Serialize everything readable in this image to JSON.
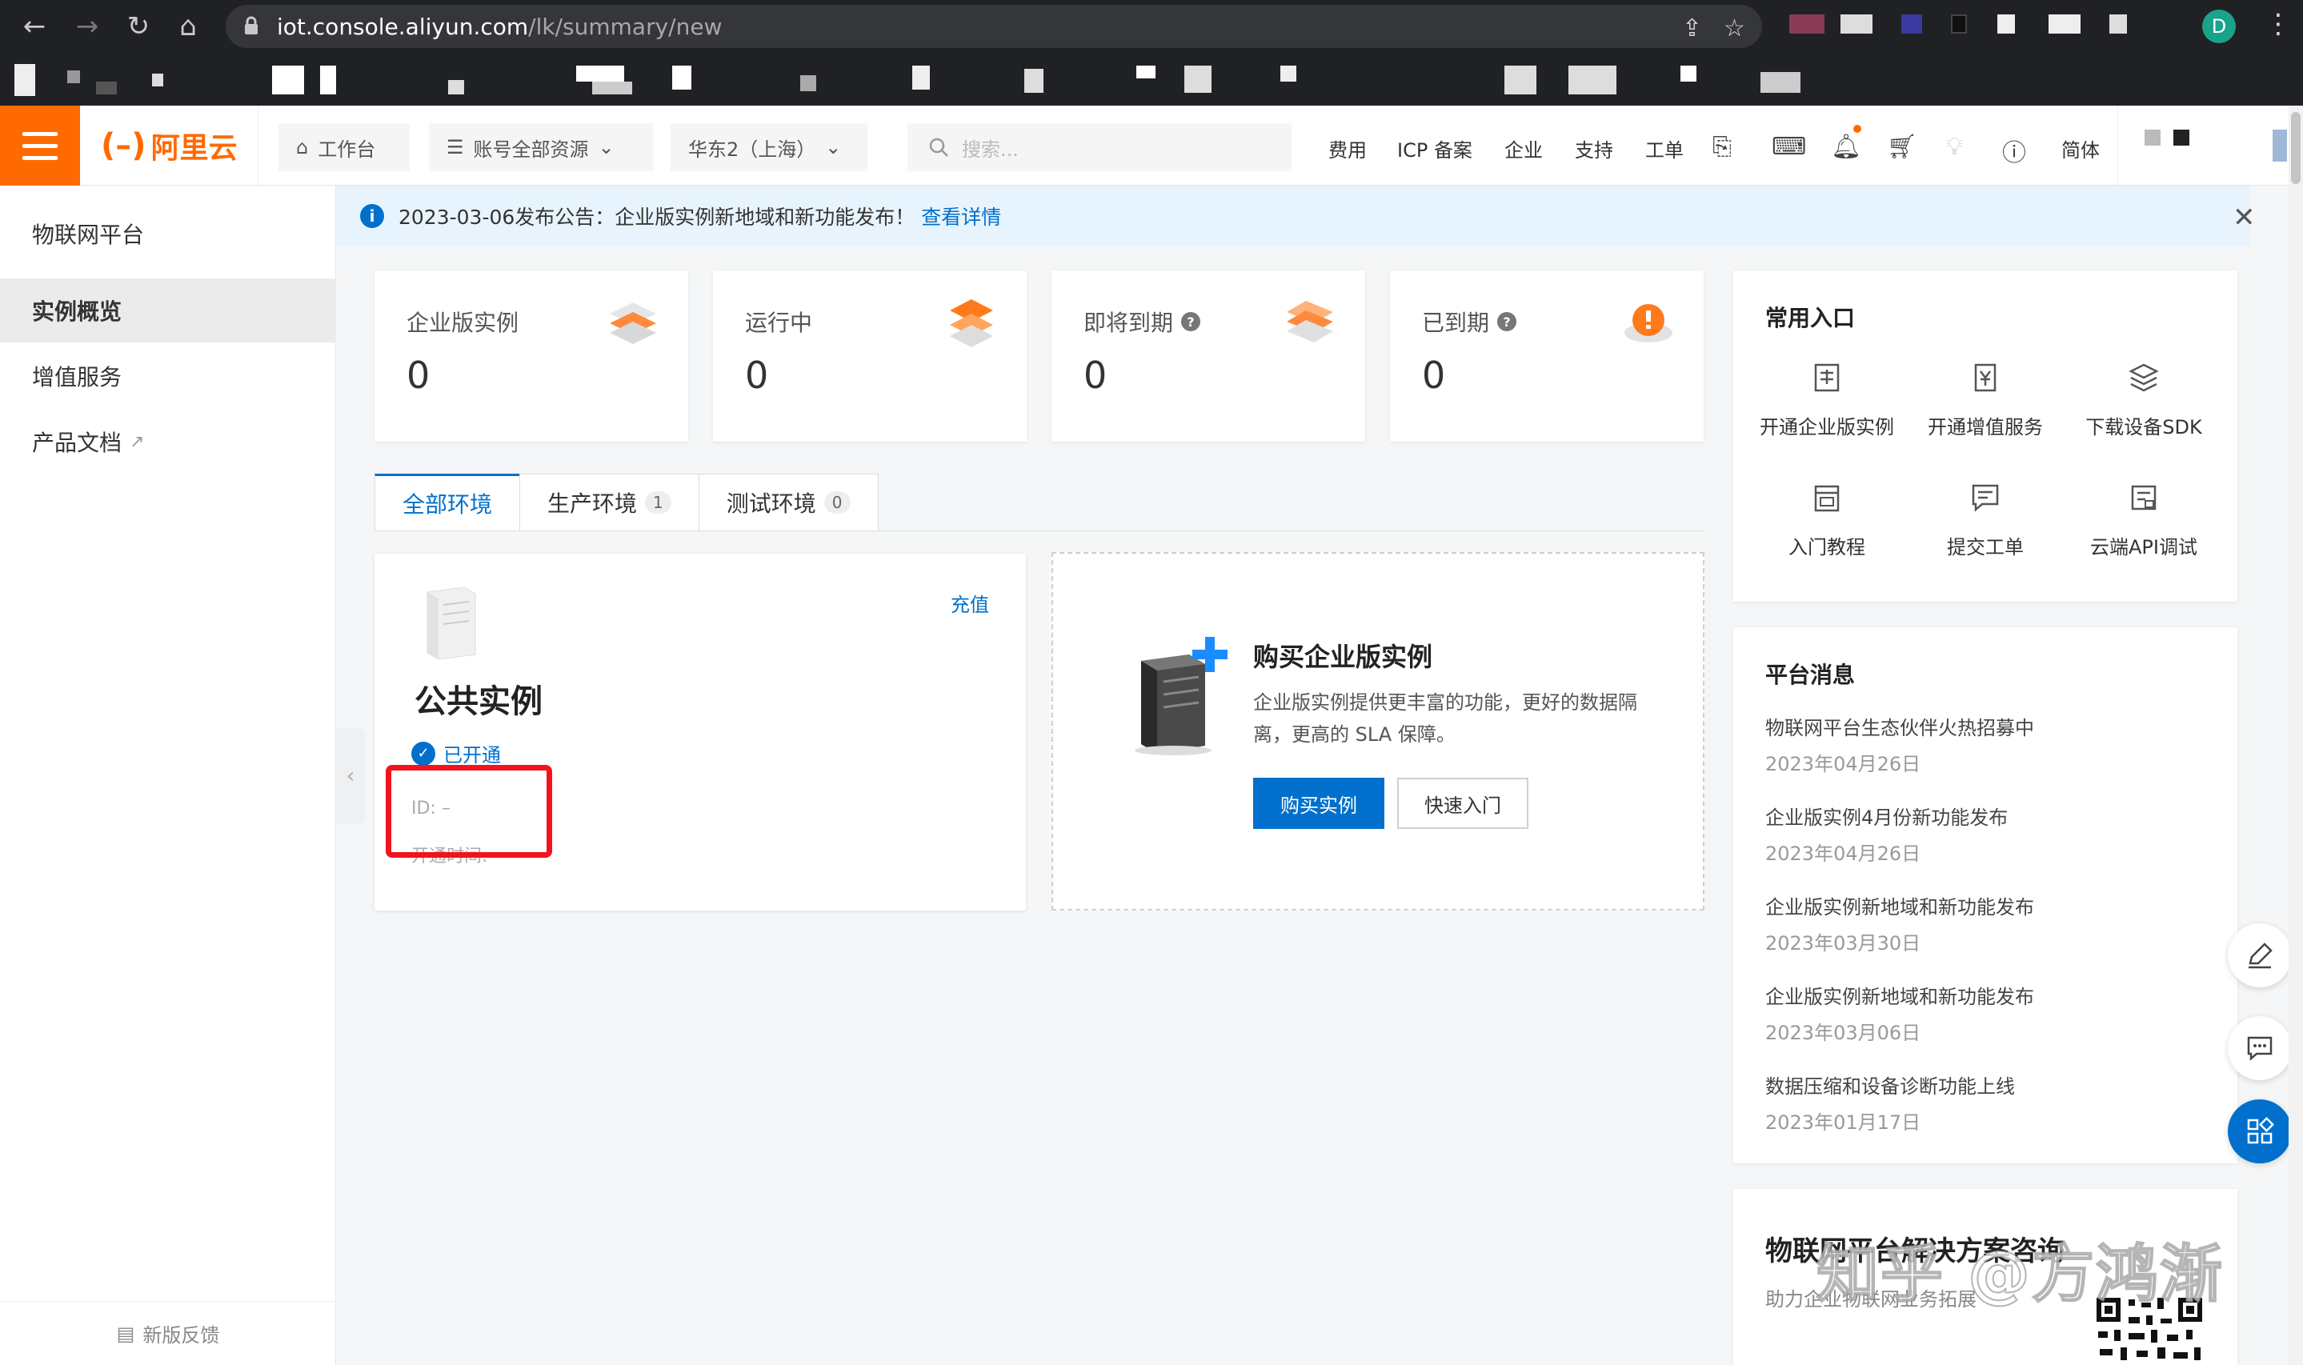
{
  "browser": {
    "url_host": "iot.console.aliyun.com",
    "url_path": "/lk/summary/new",
    "profile_initial": "D"
  },
  "topnav": {
    "logo_text": "阿里云",
    "workbench": "工作台",
    "resources": "账号全部资源",
    "region": "华东2（上海）",
    "search_placeholder": "搜索...",
    "links": [
      "费用",
      "ICP 备案",
      "企业",
      "支持",
      "工单"
    ],
    "lang": "简体"
  },
  "sidebar": {
    "title": "物联网平台",
    "items": [
      {
        "label": "实例概览",
        "active": true
      },
      {
        "label": "增值服务",
        "active": false
      },
      {
        "label": "产品文档",
        "active": false
      }
    ],
    "feedback": "新版反馈"
  },
  "announcement": {
    "text": "2023-03-06发布公告：企业版实例新地域和新功能发布！",
    "link": "查看详情"
  },
  "stats": [
    {
      "label": "企业版实例",
      "value": "0"
    },
    {
      "label": "运行中",
      "value": "0"
    },
    {
      "label": "即将到期",
      "value": "0"
    },
    {
      "label": "已到期",
      "value": "0"
    }
  ],
  "tabs": [
    {
      "label": "全部环境",
      "count": ""
    },
    {
      "label": "生产环境",
      "count": "1"
    },
    {
      "label": "测试环境",
      "count": "0"
    }
  ],
  "public_instance": {
    "recharge": "充值",
    "title": "公共实例",
    "status": "已开通",
    "id_line": "ID: –",
    "time_line": "开通时间: –"
  },
  "buy_card": {
    "title": "购买企业版实例",
    "desc": "企业版实例提供更丰富的功能，更好的数据隔离，更高的 SLA 保障。",
    "buy_button": "购买实例",
    "quickstart_button": "快速入门"
  },
  "entries": {
    "title": "常用入口",
    "items": [
      {
        "label": "开通企业版实例",
        "icon": "building-icon"
      },
      {
        "label": "开通增值服务",
        "icon": "yen-doc-icon"
      },
      {
        "label": "下载设备SDK",
        "icon": "layers-icon"
      },
      {
        "label": "入门教程",
        "icon": "book-icon"
      },
      {
        "label": "提交工单",
        "icon": "ticket-icon"
      },
      {
        "label": "云端API调试",
        "icon": "api-icon"
      }
    ]
  },
  "messages": {
    "title": "平台消息",
    "items": [
      {
        "title": "物联网平台生态伙伴火热招募中",
        "date": "2023年04月26日"
      },
      {
        "title": "企业版实例4月份新功能发布",
        "date": "2023年04月26日"
      },
      {
        "title": "企业版实例新地域和新功能发布",
        "date": "2023年03月30日"
      },
      {
        "title": "企业版实例新地域和新功能发布",
        "date": "2023年03月06日"
      },
      {
        "title": "数据压缩和设备诊断功能上线",
        "date": "2023年01月17日"
      }
    ]
  },
  "solution": {
    "title": "物联网平台解决方案咨询",
    "subtitle": "助力企业物联网业务拓展"
  },
  "watermark": "知乎 @方鸿渐",
  "colors": {
    "accent": "#0070cc",
    "brand": "#ff6a00",
    "highlight": "#f0141e"
  }
}
